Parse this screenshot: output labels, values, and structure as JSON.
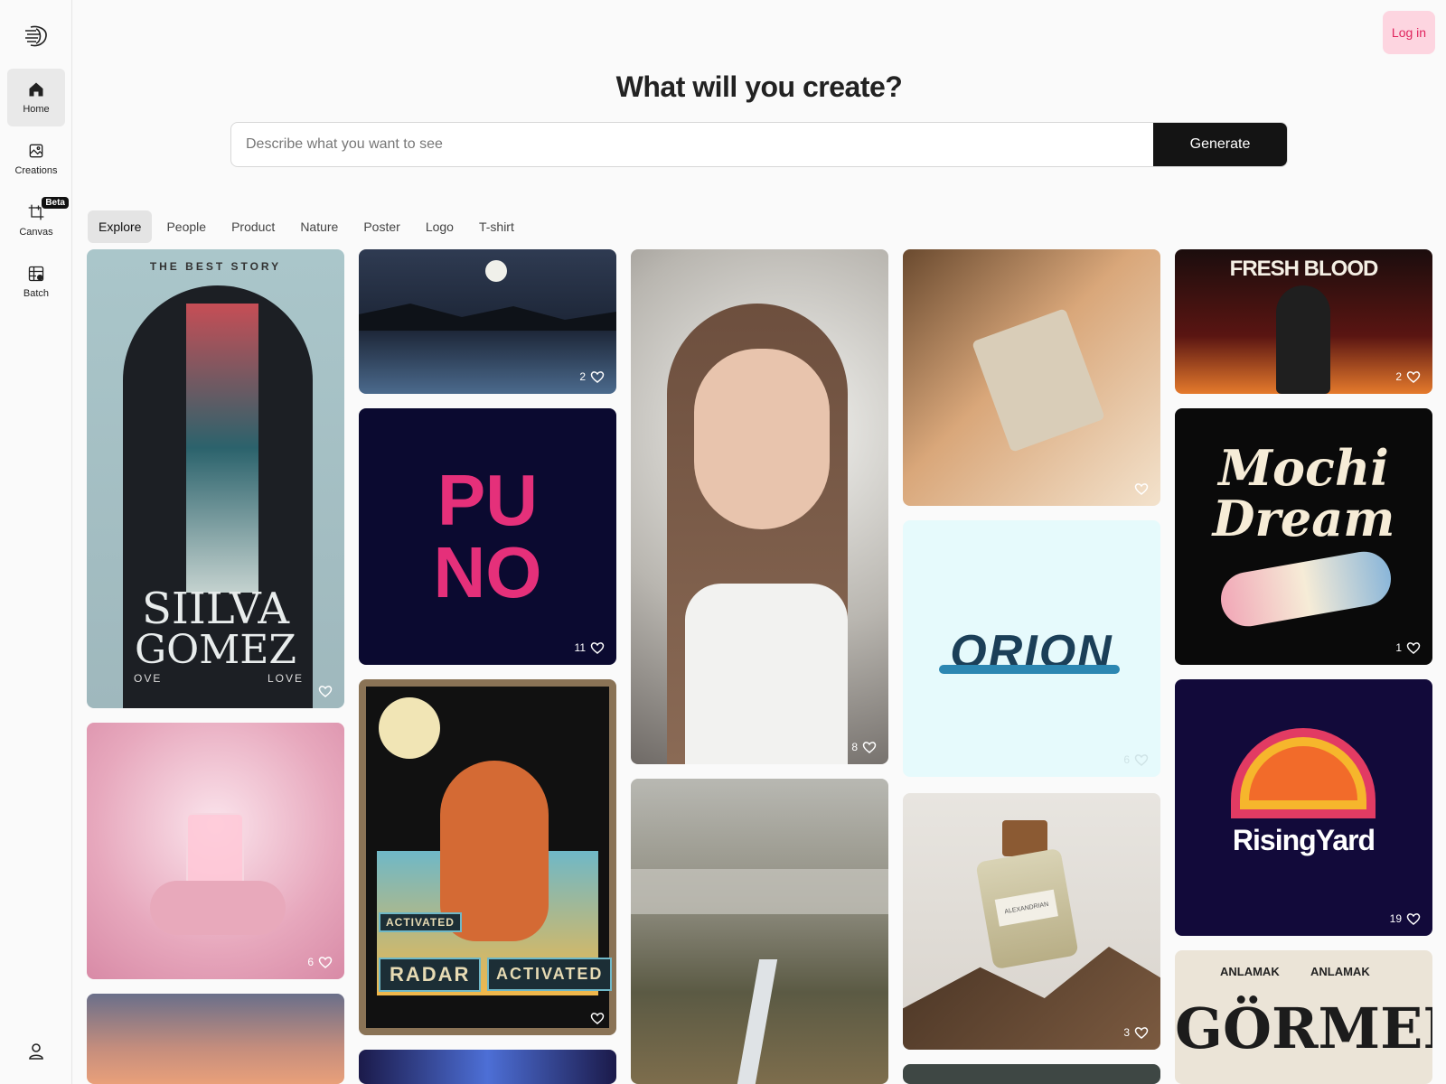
{
  "header": {
    "login_label": "Log in",
    "title": "What will you create?"
  },
  "search": {
    "placeholder": "Describe what you want to see",
    "value": "",
    "generate_label": "Generate"
  },
  "sidebar": {
    "items": [
      {
        "label": "Home",
        "icon": "home-icon",
        "active": true
      },
      {
        "label": "Creations",
        "icon": "image-icon"
      },
      {
        "label": "Canvas",
        "icon": "crop-icon",
        "badge": "Beta"
      },
      {
        "label": "Batch",
        "icon": "grid-icon"
      }
    ]
  },
  "tabs": [
    "Explore",
    "People",
    "Product",
    "Nature",
    "Poster",
    "Logo",
    "T-shirt"
  ],
  "gallery": {
    "silva": {
      "top": "THE BEST STORY",
      "line1": "SIILVA",
      "line2": "GOMEZ",
      "left": "OVE",
      "right": "LOVE",
      "likes": ""
    },
    "moon": {
      "likes": "2"
    },
    "puno": {
      "line1": "PU",
      "line2": "NO",
      "likes": "11"
    },
    "portrait": {
      "likes": "8"
    },
    "bag": {
      "likes": ""
    },
    "freshblood": {
      "title": "FRESH BLOOD",
      "likes": "2"
    },
    "mochi": {
      "line1": "Mochi",
      "line2": "Dream",
      "likes": "1"
    },
    "orion": {
      "title": "ORION",
      "likes": "6"
    },
    "perfume": {
      "likes": "6"
    },
    "fox": {
      "badge1": "ACTIVATED",
      "badge2": "RADAR",
      "badge3": "ACTIVATED",
      "likes": ""
    },
    "risingyard": {
      "title": "RisingYard",
      "likes": "19"
    },
    "bottle": {
      "label": "ALEXANDRIAN",
      "likes": "3"
    },
    "gormek": {
      "arc1": "ANLAMAK",
      "arc2": "ANLAMAK",
      "title": "GÖRMEK"
    }
  },
  "colors": {
    "accent_pink": "#e0245e",
    "login_bg": "#fdd5e0",
    "button_dark": "#141414"
  }
}
